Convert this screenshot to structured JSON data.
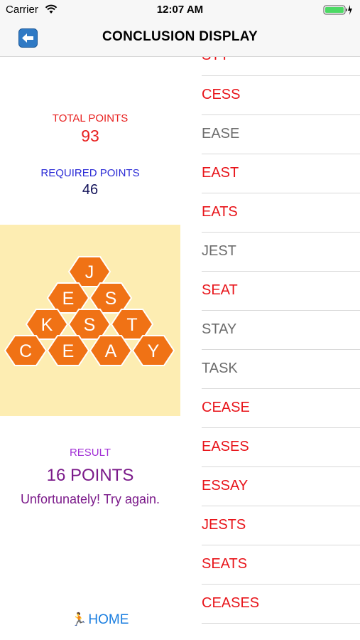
{
  "status_bar": {
    "carrier": "Carrier",
    "time": "12:07 AM"
  },
  "nav": {
    "title": "CONCLUSION DISPLAY",
    "back_icon": "back-arrow-icon"
  },
  "scores": {
    "total_label": "TOTAL POINTS",
    "total_value": "93",
    "required_label": "REQUIRED POINTS",
    "required_value": "46"
  },
  "board": {
    "rows": [
      [
        "J"
      ],
      [
        "E",
        "S"
      ],
      [
        "K",
        "S",
        "T"
      ],
      [
        "C",
        "E",
        "A",
        "Y"
      ]
    ],
    "tile_color": "#f07215",
    "background": "#fdedb2"
  },
  "result": {
    "label": "RESULT",
    "points": "16 POINTS",
    "message": "Unfortunately! Try again."
  },
  "home": {
    "label": "HOME"
  },
  "words": [
    {
      "text": "STY",
      "valid": true
    },
    {
      "text": "CESS",
      "valid": true
    },
    {
      "text": "EASE",
      "valid": false
    },
    {
      "text": "EAST",
      "valid": true
    },
    {
      "text": "EATS",
      "valid": true
    },
    {
      "text": "JEST",
      "valid": false
    },
    {
      "text": "SEAT",
      "valid": true
    },
    {
      "text": "STAY",
      "valid": false
    },
    {
      "text": "TASK",
      "valid": false
    },
    {
      "text": "CEASE",
      "valid": true
    },
    {
      "text": "EASES",
      "valid": true
    },
    {
      "text": "ESSAY",
      "valid": true
    },
    {
      "text": "JESTS",
      "valid": true
    },
    {
      "text": "SEATS",
      "valid": true
    },
    {
      "text": "CEASES",
      "valid": true
    }
  ]
}
